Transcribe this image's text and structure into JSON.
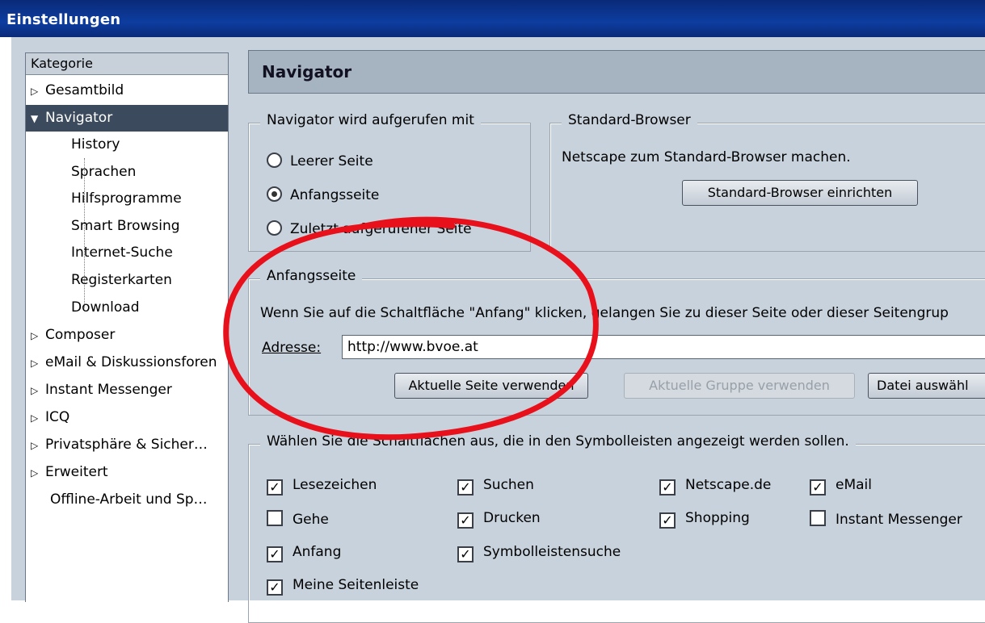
{
  "window": {
    "title": "Einstellungen"
  },
  "sidebar": {
    "header": "Kategorie",
    "items": [
      {
        "label": "Gesamtbild",
        "arrow": "▷"
      },
      {
        "label": "Navigator",
        "arrow": "▼"
      },
      {
        "label": "History"
      },
      {
        "label": "Sprachen"
      },
      {
        "label": "Hilfsprogramme"
      },
      {
        "label": "Smart Browsing"
      },
      {
        "label": "Internet-Suche"
      },
      {
        "label": "Registerkarten"
      },
      {
        "label": "Download"
      },
      {
        "label": "Composer",
        "arrow": "▷"
      },
      {
        "label": "eMail & Diskussionsforen",
        "arrow": "▷"
      },
      {
        "label": "Instant Messenger",
        "arrow": "▷"
      },
      {
        "label": "ICQ",
        "arrow": "▷"
      },
      {
        "label": "Privatsphäre & Sicher…",
        "arrow": "▷"
      },
      {
        "label": "Erweitert",
        "arrow": "▷"
      },
      {
        "label": "Offline-Arbeit und Sp…"
      }
    ]
  },
  "pane": {
    "title": "Navigator",
    "startup": {
      "legend": "Navigator wird aufgerufen mit",
      "options": [
        "Leerer Seite",
        "Anfangsseite",
        "Zuletzt aufgerufener Seite"
      ],
      "selected": "Anfangsseite"
    },
    "default_browser": {
      "legend": "Standard-Browser",
      "text": "Netscape zum Standard-Browser machen.",
      "button": "Standard-Browser einrichten"
    },
    "homepage": {
      "legend": "Anfangsseite",
      "text": "Wenn Sie auf die Schaltfläche \"Anfang\" klicken, gelangen Sie zu dieser Seite oder dieser Seitengrup",
      "address_label": "Adresse:",
      "address_value": "http://www.bvoe.at",
      "btn_current_page": "Aktuelle Seite verwenden",
      "btn_current_group": "Aktuelle Gruppe verwenden",
      "btn_choose_file": "Datei auswähl"
    },
    "toolbar_buttons": {
      "legend": "Wählen Sie die Schaltflächen aus, die in den Symbolleisten angezeigt werden sollen.",
      "items": [
        {
          "label": "Lesezeichen",
          "checked": true
        },
        {
          "label": "Suchen",
          "checked": true
        },
        {
          "label": "Netscape.de",
          "checked": true
        },
        {
          "label": "eMail",
          "checked": true
        },
        {
          "label": "Gehe",
          "checked": false
        },
        {
          "label": "Drucken",
          "checked": true
        },
        {
          "label": "Shopping",
          "checked": true
        },
        {
          "label": "Instant Messenger",
          "checked": false
        },
        {
          "label": "Anfang",
          "checked": true
        },
        {
          "label": "Symbolleistensuche",
          "checked": true
        },
        {
          "label": "Meine Seitenleiste",
          "checked": true
        }
      ]
    }
  },
  "colors": {
    "titlebar": "#0a2a78",
    "client": "#c8d2dc",
    "selection": "#3b4a5c",
    "annotation": "#e8101a"
  }
}
